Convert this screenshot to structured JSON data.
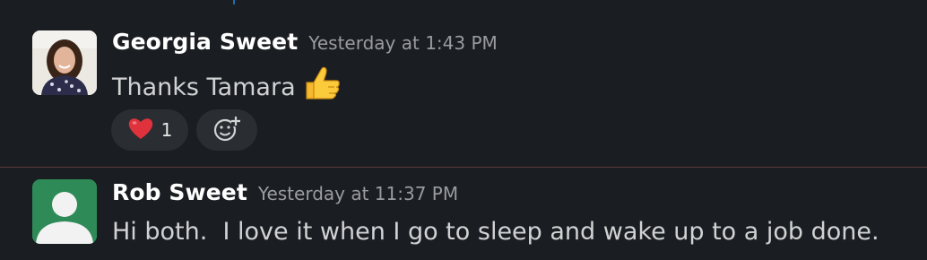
{
  "messages": [
    {
      "sender": "Georgia Sweet",
      "timestamp": "Yesterday at 1:43 PM",
      "text": "Thanks Tamara",
      "emoji_icon": "thumbs-up-icon",
      "reactions": [
        {
          "icon": "heart-icon",
          "count": "1"
        }
      ],
      "add_reaction_icon": "add-reaction-icon"
    },
    {
      "sender": "Rob Sweet",
      "timestamp": "Yesterday at 11:37 PM",
      "text": "Hi both.  I love it when I go to sleep and wake up to a job done.",
      "avatar_icon": "default-user-icon"
    }
  ],
  "colors": {
    "background": "#1a1d21",
    "divider": "#5a3a36",
    "default_avatar": "#2e8b57",
    "reaction_pill": "#2a2d31"
  }
}
